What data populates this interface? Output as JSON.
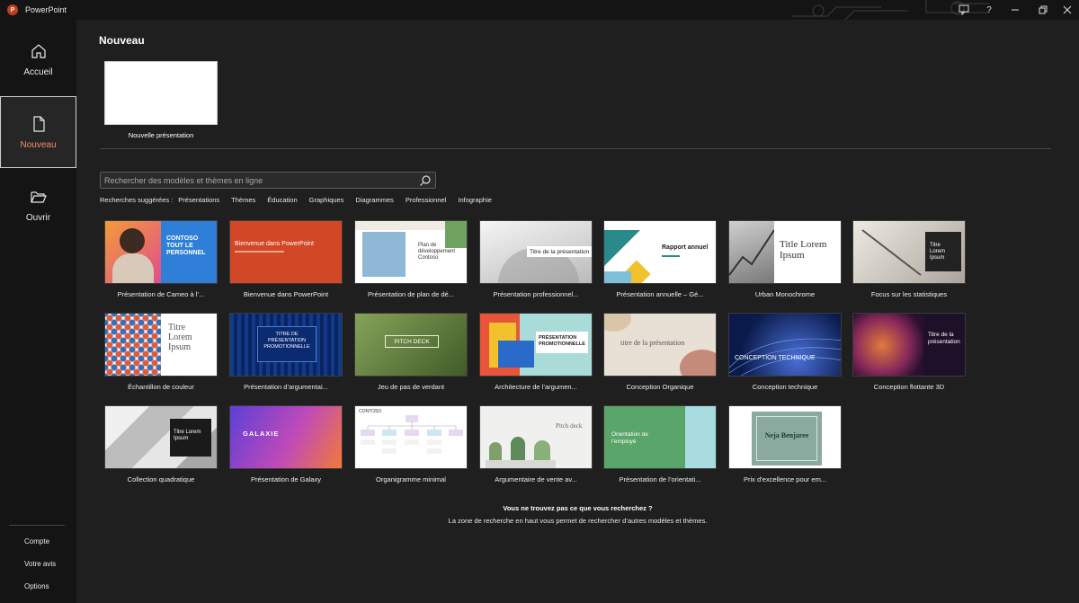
{
  "app": {
    "title": "PowerPoint",
    "logo_letter": "P"
  },
  "titlebar": {
    "help_label": "?"
  },
  "sidebar": {
    "items": [
      {
        "label": "Accueil",
        "icon": "home-icon"
      },
      {
        "label": "Nouveau",
        "icon": "new-document-icon"
      },
      {
        "label": "Ouvrir",
        "icon": "folder-open-icon"
      }
    ],
    "footer": [
      "Compte",
      "Votre avis",
      "Options"
    ]
  },
  "main": {
    "title": "Nouveau",
    "blank_label": "Nouvelle présentation",
    "search_placeholder": "Rechercher des modèles et thèmes en ligne",
    "suggest_lead": "Recherches suggérées :",
    "suggestions": [
      "Présentations",
      "Thèmes",
      "Éducation",
      "Graphiques",
      "Diagrammes",
      "Professionnel",
      "Infographie"
    ],
    "not_found_title": "Vous ne trouvez pas ce que vous recherchez ?",
    "not_found_text": "La zone de recherche en haut vous permet de rechercher d’autres modèles et thèmes."
  },
  "templates": [
    {
      "label": "Présentation de Cameo à l’...",
      "thumb": [
        "CONTOSO",
        "TOUT LE",
        "PERSONNEL"
      ]
    },
    {
      "label": "Bienvenue dans PowerPoint",
      "thumb": [
        "Bienvenue dans PowerPoint"
      ]
    },
    {
      "label": "Présentation de plan de dé...",
      "thumb": [
        "Plan de",
        "développement",
        "Contoso"
      ]
    },
    {
      "label": "Présentation professionnel...",
      "thumb": [
        "Titre de la présentation"
      ]
    },
    {
      "label": "Présentation annuelle – Gé...",
      "thumb": [
        "Rapport annuel"
      ]
    },
    {
      "label": "Urban Monochrome",
      "thumb": [
        "Title Lorem",
        "Ipsum"
      ]
    },
    {
      "label": "Focus sur les statistiques",
      "thumb": [
        "Titre",
        "Lorem",
        "Ipsum"
      ]
    },
    {
      "label": "Échantillon de couleur",
      "thumb": [
        "Titre",
        "Lorem",
        "Ipsum"
      ]
    },
    {
      "label": "Présentation d’argumentai...",
      "thumb": [
        "TITRE DE",
        "PRÉSENTATION",
        "PROMOTIONNELLE"
      ]
    },
    {
      "label": "Jeu de pas de verdant",
      "thumb": [
        "PITCH DECK"
      ]
    },
    {
      "label": "Architecture de l’argumen...",
      "thumb": [
        "PRÉSENTATION",
        "PROMOTIONNELLE"
      ]
    },
    {
      "label": "Conception Organique",
      "thumb": [
        "titre de la présentation"
      ]
    },
    {
      "label": "Conception technique",
      "thumb": [
        "CONCEPTION TECHNIQUE"
      ]
    },
    {
      "label": "Conception flottante 3D",
      "thumb": [
        "Titre de la",
        "présentation"
      ]
    },
    {
      "label": "Collection quadratique",
      "thumb": [
        "Titre Lorem",
        "Ipsum"
      ]
    },
    {
      "label": "Présentation de Galaxy",
      "thumb": [
        "GALAXIE"
      ]
    },
    {
      "label": "Organigramme minimal",
      "thumb": [
        "CONTOSO"
      ]
    },
    {
      "label": "Argumentaire de vente av...",
      "thumb": [
        "Pitch deck"
      ]
    },
    {
      "label": "Présentation de l’orientati...",
      "thumb": [
        "Orientation de",
        "l’employé"
      ]
    },
    {
      "label": "Prix d’excellence pour em...",
      "thumb": [
        "Neja Benjaree"
      ]
    }
  ],
  "colors": {
    "accent": "#f28c68",
    "background": "#1f1f1f",
    "sidebar": "#141414",
    "powerpoint": "#c43e1c"
  }
}
